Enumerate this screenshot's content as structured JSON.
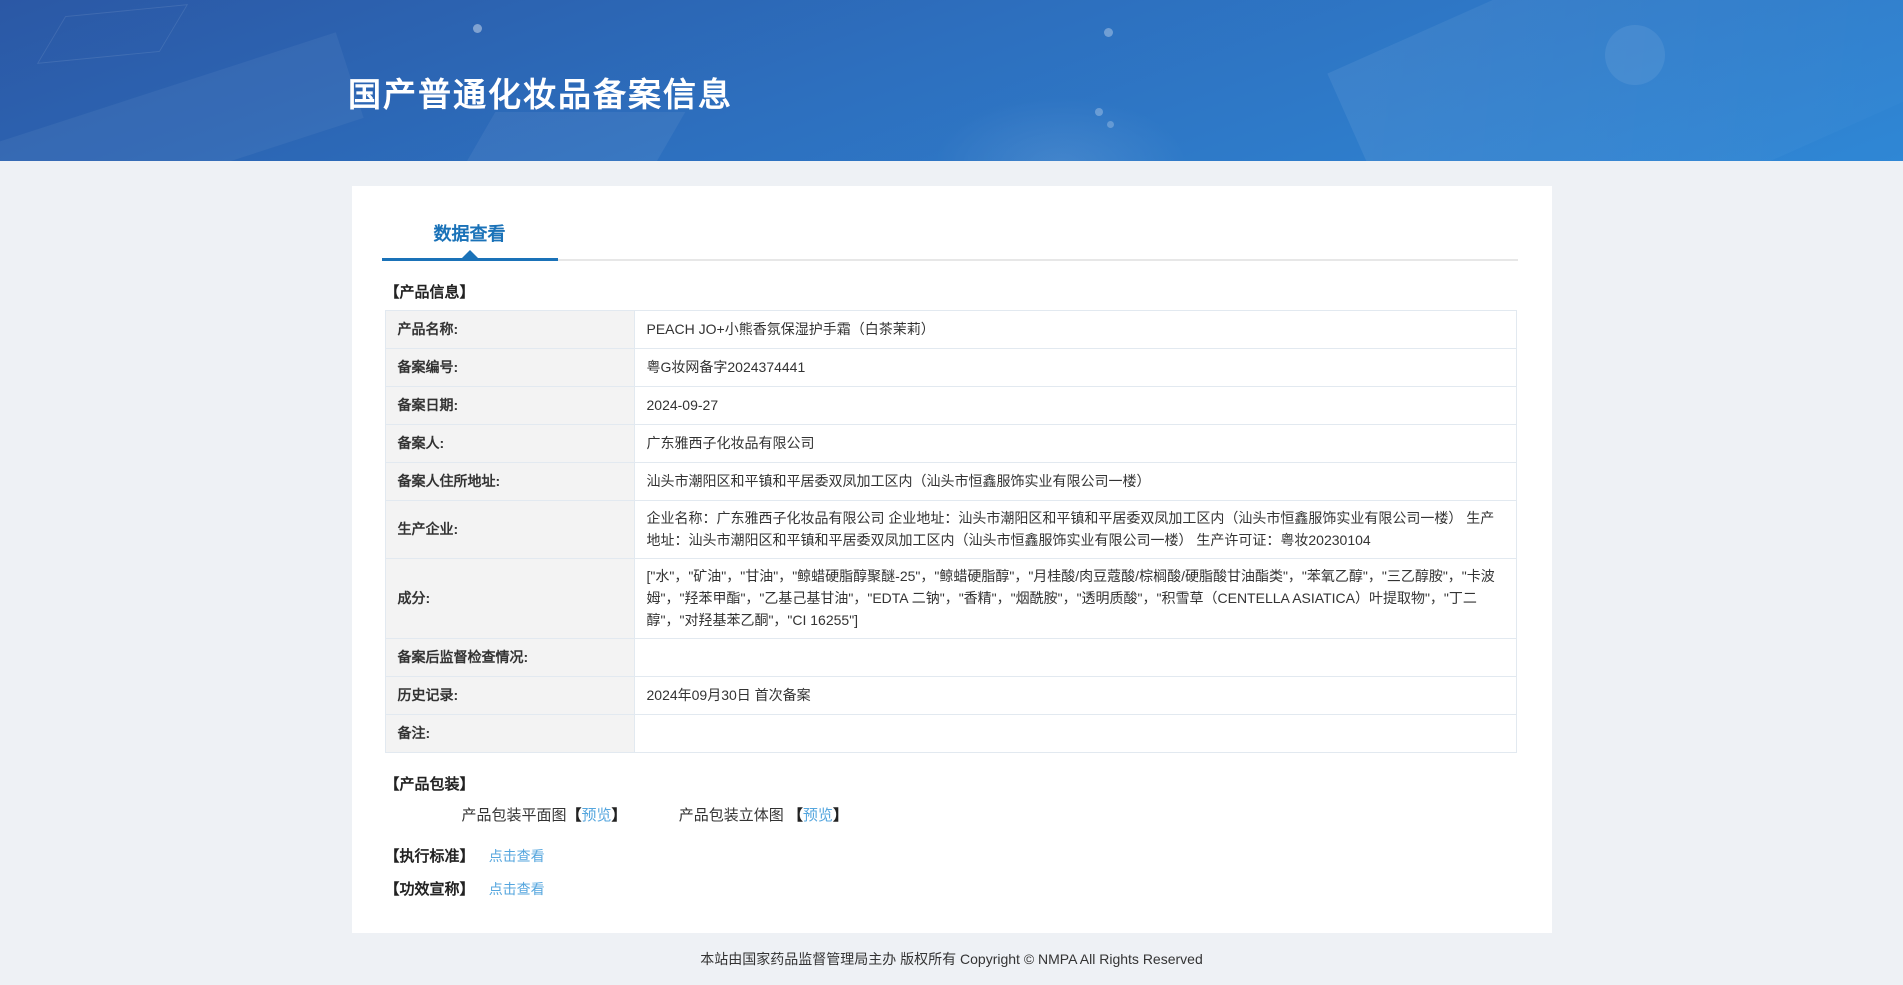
{
  "header": {
    "title": "国产普通化妆品备案信息"
  },
  "tabs": {
    "active_label": "数据查看"
  },
  "product_info": {
    "section_title": "【产品信息】",
    "rows": [
      {
        "label": "产品名称:",
        "value": "PEACH JO+小熊香氛保湿护手霜（白茶茉莉）"
      },
      {
        "label": "备案编号:",
        "value": "粤G妆网备字2024374441"
      },
      {
        "label": "备案日期:",
        "value": "2024-09-27"
      },
      {
        "label": "备案人:",
        "value": "广东雅西子化妆品有限公司"
      },
      {
        "label": "备案人住所地址:",
        "value": "汕头市潮阳区和平镇和平居委双凤加工区内（汕头市恒鑫服饰实业有限公司一楼）"
      },
      {
        "label": "生产企业:",
        "value": "企业名称：广东雅西子化妆品有限公司 企业地址：汕头市潮阳区和平镇和平居委双凤加工区内（汕头市恒鑫服饰实业有限公司一楼） 生产地址：汕头市潮阳区和平镇和平居委双凤加工区内（汕头市恒鑫服饰实业有限公司一楼） 生产许可证：粤妆20230104"
      },
      {
        "label": "成分:",
        "value": "[\"水\"，\"矿油\"，\"甘油\"，\"鲸蜡硬脂醇聚醚-25\"，\"鲸蜡硬脂醇\"，\"月桂酸/肉豆蔻酸/棕榈酸/硬脂酸甘油酯类\"，\"苯氧乙醇\"，\"三乙醇胺\"，\"卡波姆\"，\"羟苯甲酯\"，\"乙基己基甘油\"，\"EDTA 二钠\"，\"香精\"，\"烟酰胺\"，\"透明质酸\"，\"积雪草（CENTELLA ASIATICA）叶提取物\"，\"丁二醇\"，\"对羟基苯乙酮\"，\"CI 16255\"]"
      },
      {
        "label": "备案后监督检查情况:",
        "value": ""
      },
      {
        "label": "历史记录:",
        "value": "2024年09月30日 首次备案"
      },
      {
        "label": "备注:",
        "value": ""
      }
    ]
  },
  "packaging": {
    "section_title": "【产品包装】",
    "flat_label": "产品包装平面图",
    "stereo_label": "产品包装立体图 ",
    "bracket_open": "【",
    "bracket_close": "】",
    "preview_label": "预览"
  },
  "standards": {
    "label": "【执行标准】",
    "link_label": "点击查看"
  },
  "efficacy": {
    "label": "【功效宣称】",
    "link_label": "点击查看"
  },
  "footer": {
    "text": "本站由国家药品监督管理局主办 版权所有 Copyright © NMPA All Rights Reserved"
  },
  "colors": {
    "accent_blue": "#1a72b8",
    "link_blue": "#55a6de",
    "header_gradient_start": "#2b58a5",
    "header_gradient_end": "#2f87d5",
    "label_cell_bg": "#f3f3f3",
    "table_outer_border": "#a9c0d6",
    "page_bg": "#eef1f5"
  }
}
